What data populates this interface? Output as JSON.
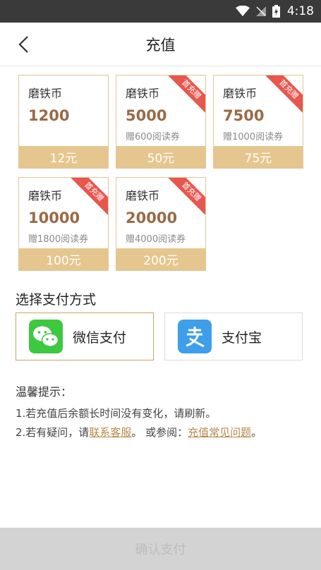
{
  "status_bar": {
    "time": "4:18"
  },
  "header": {
    "title": "充值"
  },
  "packages": [
    {
      "name": "磨铁币",
      "amount": "1200",
      "bonus": "",
      "price": "12元",
      "badge": ""
    },
    {
      "name": "磨铁币",
      "amount": "5000",
      "bonus": "赠600阅读券",
      "price": "50元",
      "badge": "首充赠"
    },
    {
      "name": "磨铁币",
      "amount": "7500",
      "bonus": "赠1000阅读券",
      "price": "75元",
      "badge": "首充赠"
    },
    {
      "name": "磨铁币",
      "amount": "10000",
      "bonus": "赠1800阅读券",
      "price": "100元",
      "badge": "首充赠"
    },
    {
      "name": "磨铁币",
      "amount": "20000",
      "bonus": "赠4000阅读券",
      "price": "200元",
      "badge": "首充赠"
    }
  ],
  "payment": {
    "title": "选择支付方式",
    "options": [
      {
        "label": "微信支付",
        "icon": "wechat-icon",
        "selected": true
      },
      {
        "label": "支付宝",
        "icon": "alipay-icon",
        "selected": false
      }
    ]
  },
  "tips": {
    "title": "温馨提示：",
    "line1": "1.若充值后余额长时间没有变化，请刷新。",
    "line2_prefix": "2.若有疑问，请",
    "line2_link1": "联系客服",
    "line2_mid": "。 或参阅：",
    "line2_link2": "充值常见问题",
    "line2_suffix": "。"
  },
  "confirm": {
    "label": "确认支付"
  },
  "colors": {
    "accent": "#e6c68f",
    "amount": "#9a6a45",
    "ribbon": "#e8564e",
    "wechat": "#3dc840",
    "alipay": "#3e9eea"
  }
}
